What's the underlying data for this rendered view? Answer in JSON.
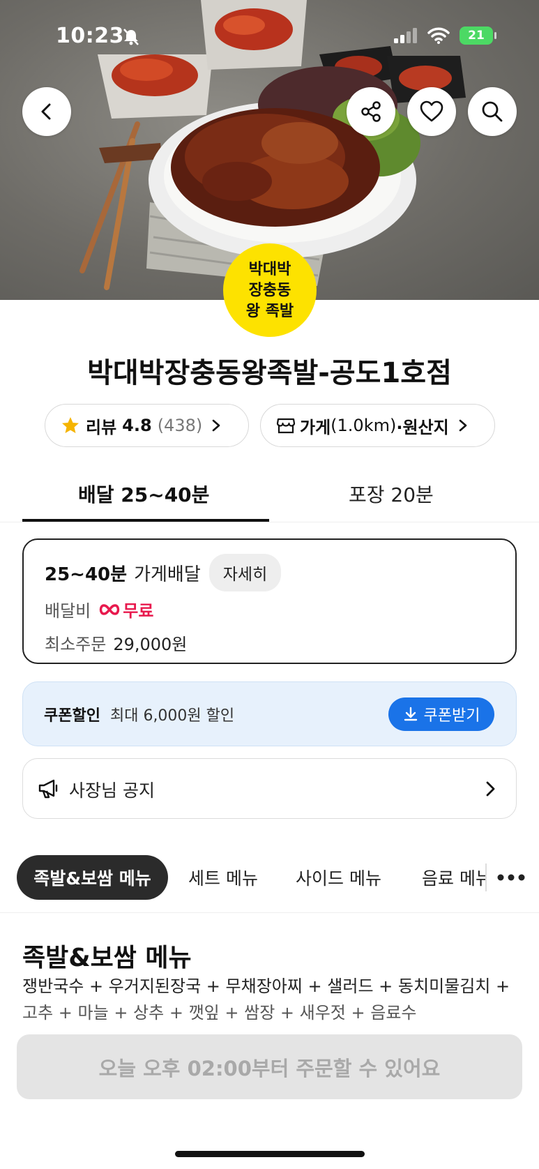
{
  "status_bar": {
    "time": "10:23",
    "battery": "21"
  },
  "hero": {
    "back_icon": "chevron-left-icon",
    "share_icon": "share-icon",
    "favorite_icon": "heart-icon",
    "search_icon": "search-icon"
  },
  "logo": {
    "line1": "박대박",
    "line2": "장충동",
    "line3": "왕 족발"
  },
  "store": {
    "name": "박대박장충동왕족발-공도1호점",
    "review_label": "리뷰",
    "rating": "4.8",
    "review_count": "(438)",
    "store_info_label": "가게",
    "distance": "(1.0km)",
    "origin_label": "·원산지"
  },
  "order_tabs": [
    {
      "label": "배달 25~40분"
    },
    {
      "label": "포장 20분"
    }
  ],
  "delivery_info": {
    "time": "25~40분",
    "type": "가게배달",
    "detail_button": "자세히",
    "fee_label": "배달비",
    "fee_value": "무료",
    "min_order_label": "최소주문",
    "min_order_value": "29,000원"
  },
  "coupon": {
    "label": "쿠폰할인",
    "description": "최대 6,000원 할인",
    "button": "쿠폰받기"
  },
  "notice": {
    "label": "사장님 공지"
  },
  "menu_categories": [
    "족발&보쌈 메뉴",
    "세트 메뉴",
    "사이드 메뉴",
    "음료 메뉴"
  ],
  "section": {
    "title": "족발&보쌈 메뉴",
    "desc_line1": "쟁반국수 + 우거지된장국 + 무채장아찌 + 샐러드 + 동치미물김치 +",
    "desc_line2": "고추 + 마늘 + 상추 + 깻잎 + 쌈장 + 새우젓 + 음료수"
  },
  "order_bar": {
    "label": "오늘 오후 02:00부터 주문할 수 있어요"
  },
  "colors": {
    "accent_red": "#e8194d",
    "coupon_blue": "#1a73e8",
    "logo_yellow": "#fde200",
    "wifi_battery_green": "#4cd964"
  }
}
